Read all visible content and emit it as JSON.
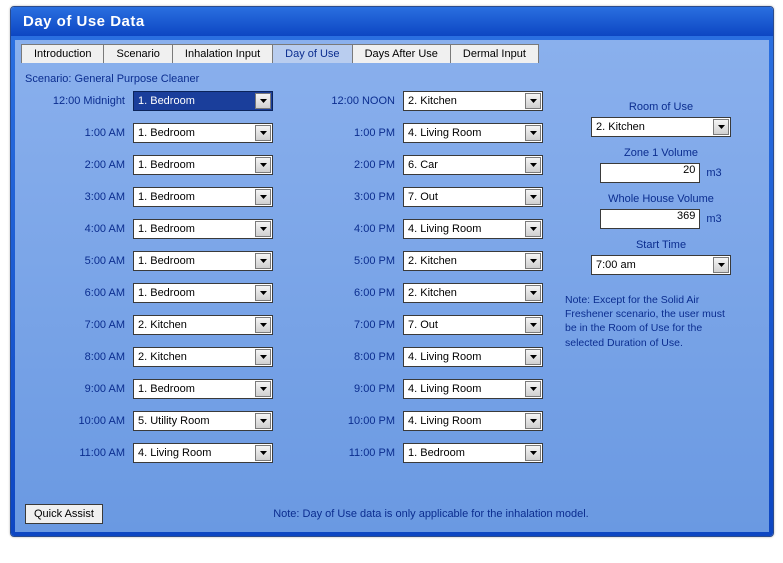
{
  "window": {
    "title": "Day of Use Data"
  },
  "tabs": [
    {
      "label": "Introduction",
      "active": false
    },
    {
      "label": "Scenario",
      "active": false
    },
    {
      "label": "Inhalation Input",
      "active": false
    },
    {
      "label": "Day of Use",
      "active": true
    },
    {
      "label": "Days After Use",
      "active": false
    },
    {
      "label": "Dermal Input",
      "active": false
    }
  ],
  "scenario_label": "Scenario: General Purpose Cleaner",
  "am": [
    {
      "time": "12:00 Midnight",
      "value": "1. Bedroom",
      "selected": true
    },
    {
      "time": "1:00 AM",
      "value": "1. Bedroom"
    },
    {
      "time": "2:00 AM",
      "value": "1. Bedroom"
    },
    {
      "time": "3:00 AM",
      "value": "1. Bedroom"
    },
    {
      "time": "4:00 AM",
      "value": "1. Bedroom"
    },
    {
      "time": "5:00 AM",
      "value": "1. Bedroom"
    },
    {
      "time": "6:00 AM",
      "value": "1. Bedroom"
    },
    {
      "time": "7:00 AM",
      "value": "2. Kitchen"
    },
    {
      "time": "8:00 AM",
      "value": "2. Kitchen"
    },
    {
      "time": "9:00 AM",
      "value": "1. Bedroom"
    },
    {
      "time": "10:00 AM",
      "value": "5. Utility Room"
    },
    {
      "time": "11:00 AM",
      "value": "4. Living Room"
    }
  ],
  "pm": [
    {
      "time": "12:00 NOON",
      "value": "2. Kitchen"
    },
    {
      "time": "1:00 PM",
      "value": "4. Living Room"
    },
    {
      "time": "2:00 PM",
      "value": "6. Car"
    },
    {
      "time": "3:00 PM",
      "value": "7. Out"
    },
    {
      "time": "4:00 PM",
      "value": "4. Living Room"
    },
    {
      "time": "5:00 PM",
      "value": "2. Kitchen"
    },
    {
      "time": "6:00 PM",
      "value": "2. Kitchen"
    },
    {
      "time": "7:00 PM",
      "value": "7. Out"
    },
    {
      "time": "8:00 PM",
      "value": "4. Living Room"
    },
    {
      "time": "9:00 PM",
      "value": "4. Living Room"
    },
    {
      "time": "10:00 PM",
      "value": "4. Living Room"
    },
    {
      "time": "11:00 PM",
      "value": "1. Bedroom"
    }
  ],
  "right": {
    "room_of_use_label": "Room of Use",
    "room_of_use_value": "2. Kitchen",
    "zone1_label": "Zone 1 Volume",
    "zone1_value": "20",
    "zone1_unit": "m3",
    "whole_house_label": "Whole House Volume",
    "whole_house_value": "369",
    "whole_house_unit": "m3",
    "start_time_label": "Start Time",
    "start_time_value": "7:00 am",
    "note": "Note: Except for the Solid Air Freshener scenario, the user must be in the Room of Use for the selected Duration of Use."
  },
  "bottom": {
    "quick_assist": "Quick Assist",
    "note": "Note: Day of Use data is only applicable for the inhalation model."
  }
}
